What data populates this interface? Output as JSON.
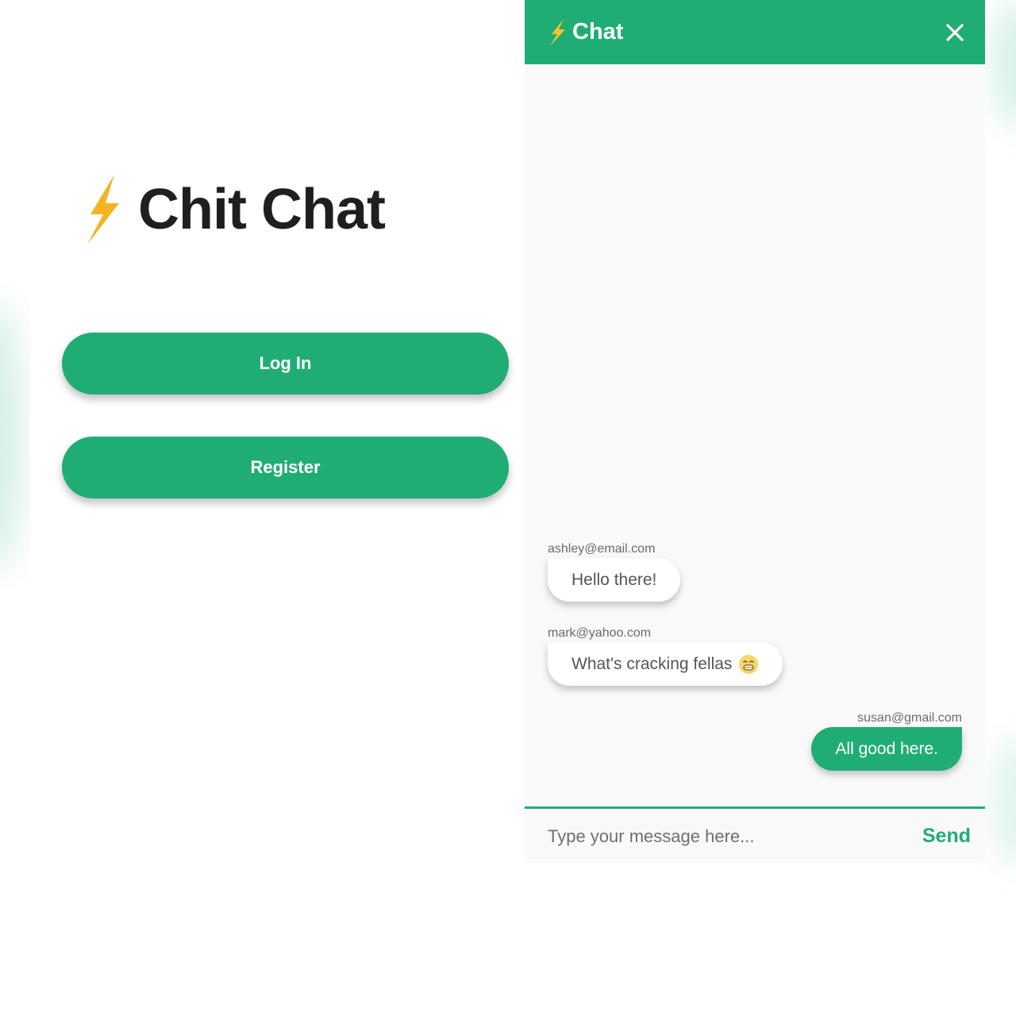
{
  "colors": {
    "accent": "#20ad74",
    "bolt": "#f5b324",
    "title_text": "#1f1f1f"
  },
  "welcome": {
    "title": "Chit Chat",
    "logo_icon": "lightning-bolt-icon",
    "login_label": "Log In",
    "register_label": "Register"
  },
  "chat": {
    "header_title": "Chat",
    "header_icon": "lightning-bolt-icon",
    "close_icon": "close-icon",
    "messages": [
      {
        "sender": "ashley@email.com",
        "text": "Hello there!",
        "direction": "incoming"
      },
      {
        "sender": "mark@yahoo.com",
        "text": "What's cracking fellas",
        "emoji": "grinning-face-icon",
        "direction": "incoming"
      },
      {
        "sender": "susan@gmail.com",
        "text": "All good here.",
        "direction": "outgoing"
      }
    ],
    "composer": {
      "placeholder": "Type your message here...",
      "value": "",
      "send_label": "Send"
    }
  }
}
